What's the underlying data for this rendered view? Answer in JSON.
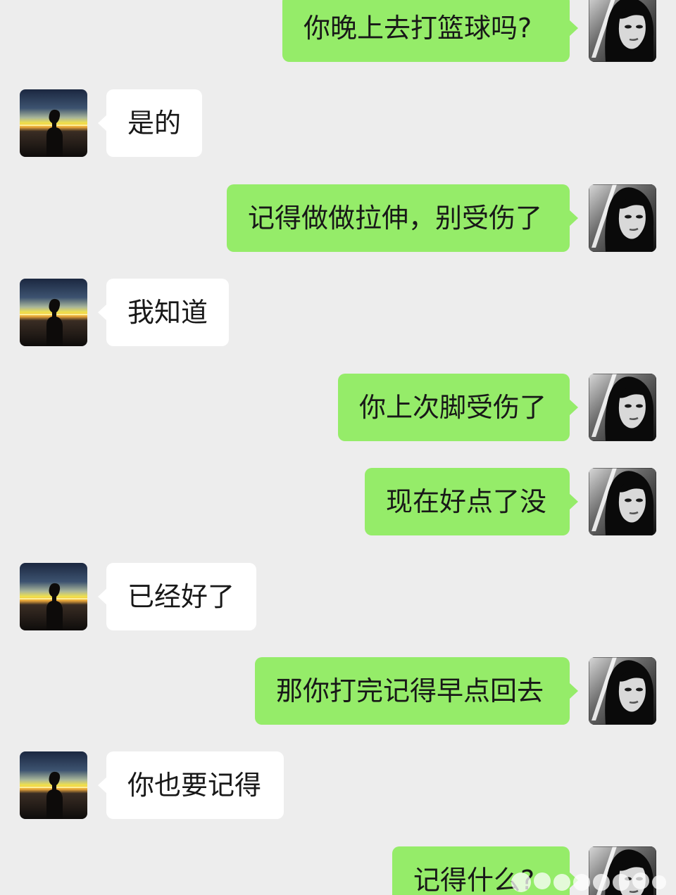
{
  "colors": {
    "background": "#ededed",
    "sent_bubble": "#95ec69",
    "received_bubble": "#ffffff",
    "text": "#181818"
  },
  "contact_avatar": "silhouette-sunset-avatar",
  "self_avatar": "dark-hair-girl-avatar",
  "messages": [
    {
      "side": "right",
      "text": "你晚上去打篮球吗?"
    },
    {
      "side": "left",
      "text": "是的"
    },
    {
      "side": "right",
      "text": "记得做做拉伸，别受伤了"
    },
    {
      "side": "left",
      "text": "我知道"
    },
    {
      "side": "right",
      "text": "你上次脚受伤了"
    },
    {
      "side": "right",
      "text": "现在好点了没"
    },
    {
      "side": "left",
      "text": "已经好了"
    },
    {
      "side": "right",
      "text": "那你打完记得早点回去"
    },
    {
      "side": "left",
      "text": "你也要记得"
    },
    {
      "side": "right",
      "text": "记得什么?"
    }
  ]
}
